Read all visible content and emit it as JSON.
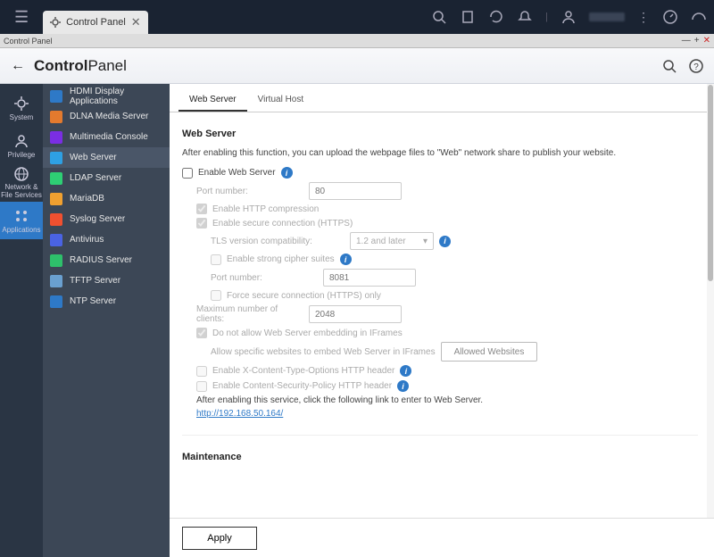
{
  "topbar": {
    "tab_label": "Control Panel"
  },
  "subbar": {
    "label": "Control Panel"
  },
  "appheader": {
    "title_bold": "Control",
    "title_rest": "Panel"
  },
  "leftnav": {
    "system": "System",
    "privilege": "Privilege",
    "network": "Network &\nFile Services",
    "applications": "Applications"
  },
  "sidelist": {
    "items": [
      {
        "label": "HDMI Display Applications",
        "color": "#2e79c7"
      },
      {
        "label": "DLNA Media Server",
        "color": "#e37a2e"
      },
      {
        "label": "Multimedia Console",
        "color": "#7a2ee3"
      },
      {
        "label": "Web Server",
        "color": "#2ea0e3",
        "active": true
      },
      {
        "label": "LDAP Server",
        "color": "#2ecf74"
      },
      {
        "label": "MariaDB",
        "color": "#f0a030"
      },
      {
        "label": "Syslog Server",
        "color": "#f05030"
      },
      {
        "label": "Antivirus",
        "color": "#4a63e3"
      },
      {
        "label": "RADIUS Server",
        "color": "#2ec06b"
      },
      {
        "label": "TFTP Server",
        "color": "#6aa0d0"
      },
      {
        "label": "NTP Server",
        "color": "#2e79c7"
      }
    ]
  },
  "tabs": {
    "web_server": "Web Server",
    "virtual_host": "Virtual Host"
  },
  "section": {
    "title": "Web Server"
  },
  "form": {
    "intro": "After enabling this function, you can upload the webpage files to \"Web\" network share to publish your website.",
    "enable": "Enable Web Server",
    "port_label": "Port number:",
    "port_value": "80",
    "http_compression": "Enable HTTP compression",
    "secure_conn": "Enable secure connection (HTTPS)",
    "tls_label": "TLS version compatibility:",
    "tls_value": "1.2 and later",
    "strong_cipher": "Enable strong cipher suites",
    "port2_label": "Port number:",
    "port2_value": "8081",
    "force_https": "Force secure connection (HTTPS) only",
    "max_clients_label": "Maximum number of clients:",
    "max_clients_value": "2048",
    "no_iframe": "Do not allow Web Server embedding in IFrames",
    "iframe_allow_note": "Allow specific websites to embed Web Server in IFrames",
    "allowed_websites_btn": "Allowed Websites",
    "xcto": "Enable X-Content-Type-Options HTTP header",
    "csp": "Enable Content-Security-Policy HTTP header",
    "enter_note": "After enabling this service, click the following link to enter to Web Server.",
    "link": "http://192.168.50.164/",
    "maintenance": "Maintenance",
    "apply": "Apply"
  }
}
